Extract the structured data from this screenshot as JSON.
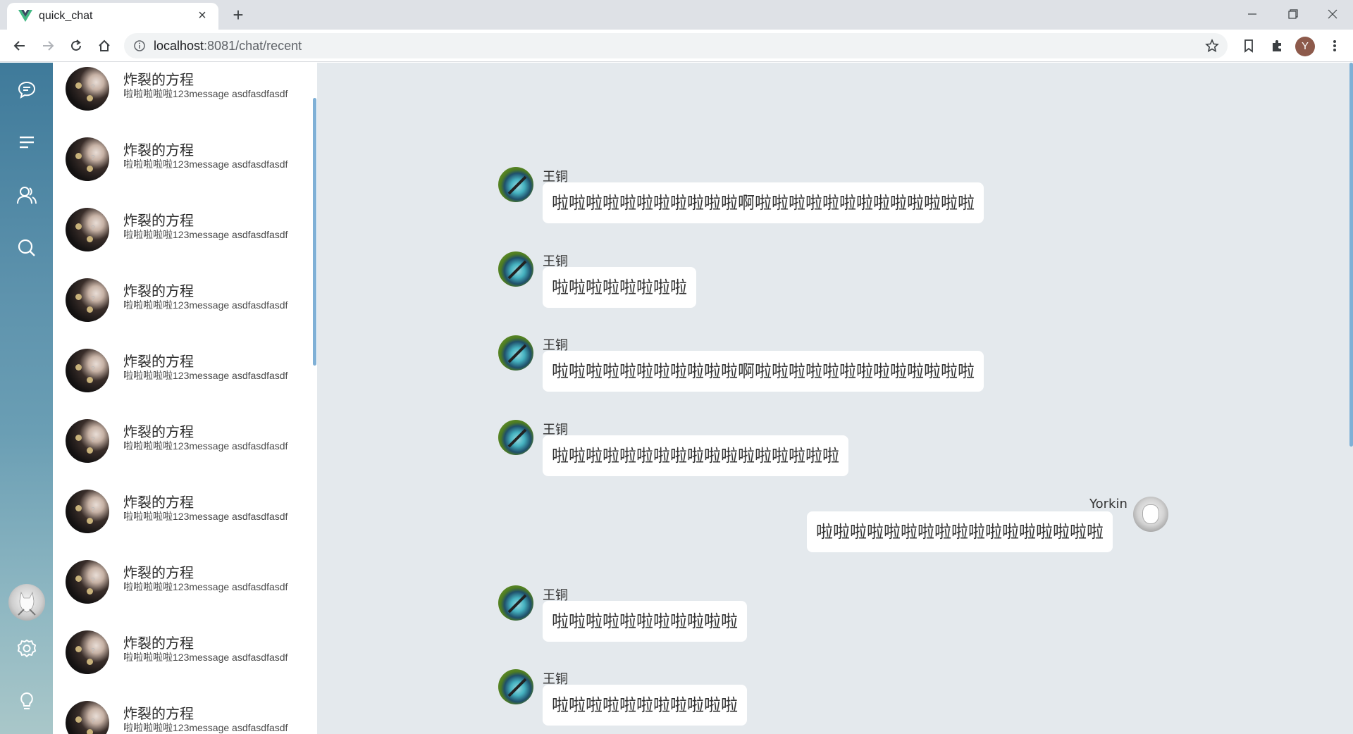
{
  "browser": {
    "tab_title": "quick_chat",
    "url_host": "localhost",
    "url_rest": ":8081/chat/recent",
    "profile_initial": "Y"
  },
  "sidebar": {
    "icons": [
      "chat-icon",
      "menu-icon",
      "contacts-icon",
      "search-icon",
      "settings-icon",
      "lightbulb-icon"
    ]
  },
  "chat_list": {
    "items": [
      {
        "name": "炸裂的方程",
        "message": "啦啦啦啦啦123message asdfasdfasdf"
      },
      {
        "name": "炸裂的方程",
        "message": "啦啦啦啦啦123message asdfasdfasdf"
      },
      {
        "name": "炸裂的方程",
        "message": "啦啦啦啦啦123message asdfasdfasdf"
      },
      {
        "name": "炸裂的方程",
        "message": "啦啦啦啦啦123message asdfasdfasdf"
      },
      {
        "name": "炸裂的方程",
        "message": "啦啦啦啦啦123message asdfasdfasdf"
      },
      {
        "name": "炸裂的方程",
        "message": "啦啦啦啦啦123message asdfasdfasdf"
      },
      {
        "name": "炸裂的方程",
        "message": "啦啦啦啦啦123message asdfasdfasdf"
      },
      {
        "name": "炸裂的方程",
        "message": "啦啦啦啦啦123message asdfasdfasdf"
      },
      {
        "name": "炸裂的方程",
        "message": "啦啦啦啦啦123message asdfasdfasdf"
      },
      {
        "name": "炸裂的方程",
        "message": "啦啦啦啦啦123message asdfasdfasdf"
      }
    ]
  },
  "messages": [
    {
      "sender": "王铜",
      "text": "啦啦啦啦啦啦啦啦啦啦啦啊啦啦啦啦啦啦啦啦啦啦啦啦啦",
      "self": false
    },
    {
      "sender": "王铜",
      "text": "啦啦啦啦啦啦啦啦",
      "self": false
    },
    {
      "sender": "王铜",
      "text": "啦啦啦啦啦啦啦啦啦啦啦啊啦啦啦啦啦啦啦啦啦啦啦啦啦",
      "self": false
    },
    {
      "sender": "王铜",
      "text": "啦啦啦啦啦啦啦啦啦啦啦啦啦啦啦啦啦",
      "self": false
    },
    {
      "sender": "Yorkin",
      "text": "啦啦啦啦啦啦啦啦啦啦啦啦啦啦啦啦啦",
      "self": true
    },
    {
      "sender": "王铜",
      "text": "啦啦啦啦啦啦啦啦啦啦啦",
      "self": false
    },
    {
      "sender": "王铜",
      "text": "啦啦啦啦啦啦啦啦啦啦啦",
      "self": false
    }
  ]
}
